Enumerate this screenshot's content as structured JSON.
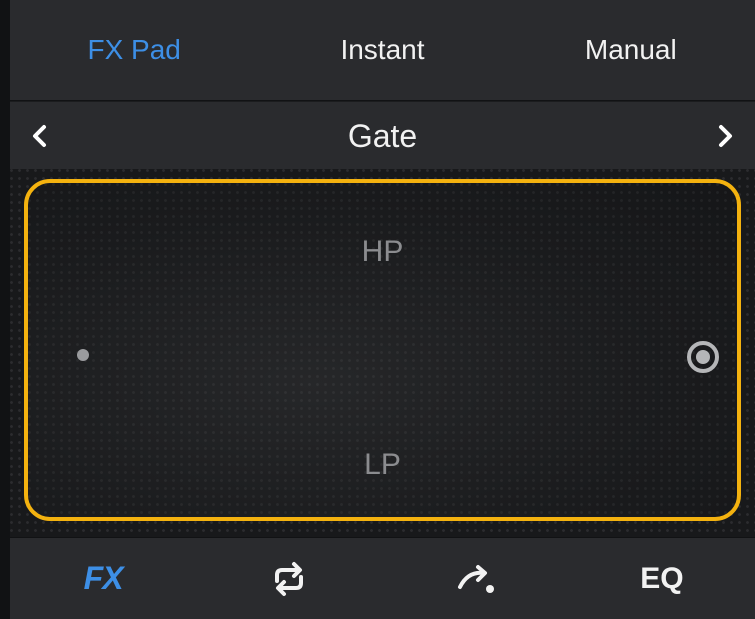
{
  "tabs": {
    "items": [
      "FX Pad",
      "Instant",
      "Manual"
    ],
    "active": "FX Pad"
  },
  "selector": {
    "title": "Gate",
    "prev_icon": "chevron-left-icon",
    "next_icon": "chevron-right-icon"
  },
  "pad": {
    "top_label": "HP",
    "bottom_label": "LP",
    "border_color": "#f4b20f"
  },
  "bottom_nav": {
    "fx_label": "FX",
    "loop_icon": "loop-icon",
    "bend_icon": "pitch-bend-icon",
    "eq_label": "EQ",
    "active": "FX"
  },
  "colors": {
    "accent": "#3d8fe6",
    "pad_border": "#f4b20f",
    "bar_bg": "#2a2b2e"
  }
}
